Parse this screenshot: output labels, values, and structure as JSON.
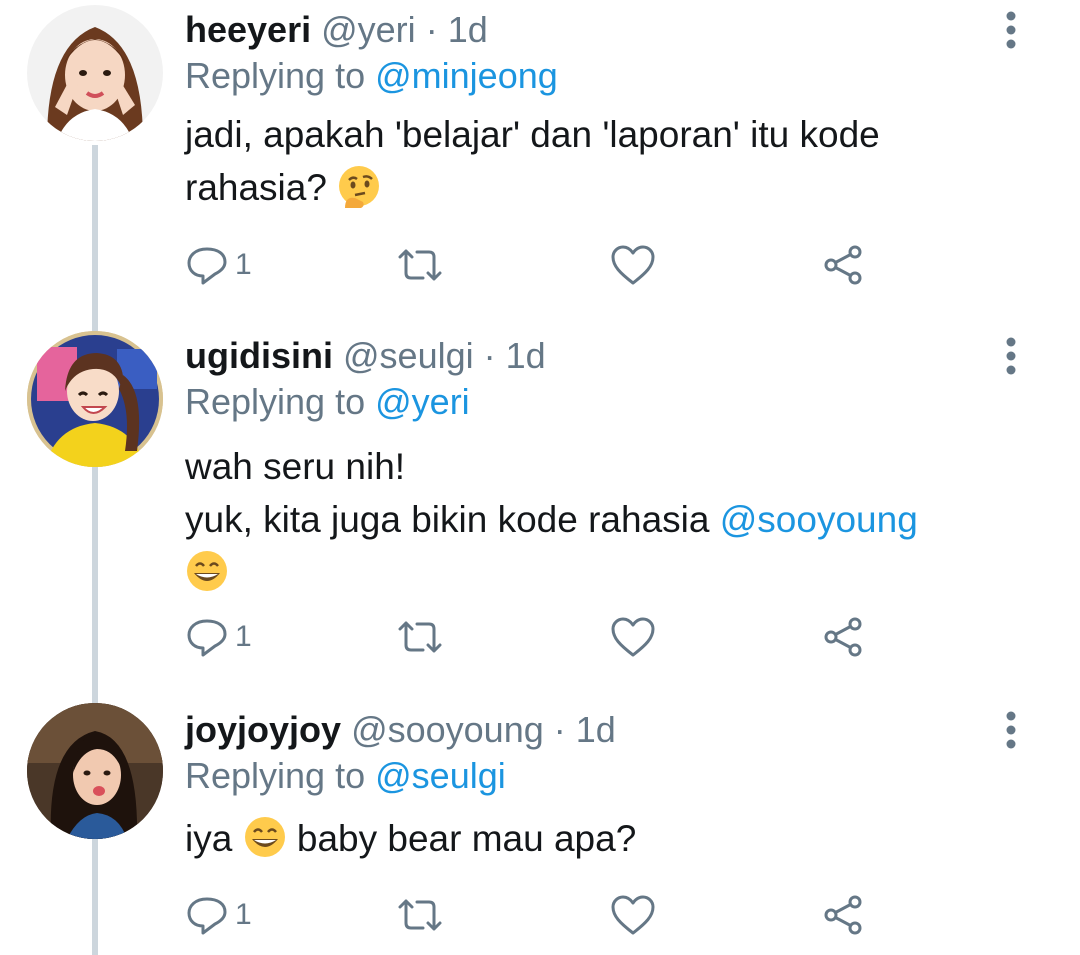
{
  "colors": {
    "accent": "#1b95e0",
    "muted": "#657786",
    "text": "#14171a",
    "thread": "#cdd6dd"
  },
  "tweets": [
    {
      "name": "heeyeri",
      "handle": "@yeri",
      "sep": "·",
      "time": "1d",
      "reply_prefix": "Replying to",
      "reply_to": "@minjeong",
      "text1": "jadi, apakah 'belajar' dan 'laporan' itu kode",
      "text2": "rahasia?",
      "emoji": "thinking-face-emoji",
      "reply_count": "1",
      "icons": [
        "reply-icon",
        "retweet-icon",
        "like-icon",
        "share-icon",
        "more-icon"
      ]
    },
    {
      "name": "ugidisini",
      "handle": "@seulgi",
      "sep": "·",
      "time": "1d",
      "reply_prefix": "Replying to",
      "reply_to": "@yeri",
      "text1": "wah seru nih!",
      "text2": "yuk, kita juga bikin kode rahasia",
      "mention": "@sooyoung",
      "emoji": "grinning-face-emoji",
      "reply_count": "1"
    },
    {
      "name": "joyjoyjoy",
      "handle": "@sooyoung",
      "sep": "·",
      "time": "1d",
      "reply_prefix": "Replying to",
      "reply_to": "@seulgi",
      "text1": "iya",
      "text2": "baby bear mau apa?",
      "emoji": "grinning-face-emoji",
      "reply_count": "1"
    }
  ]
}
